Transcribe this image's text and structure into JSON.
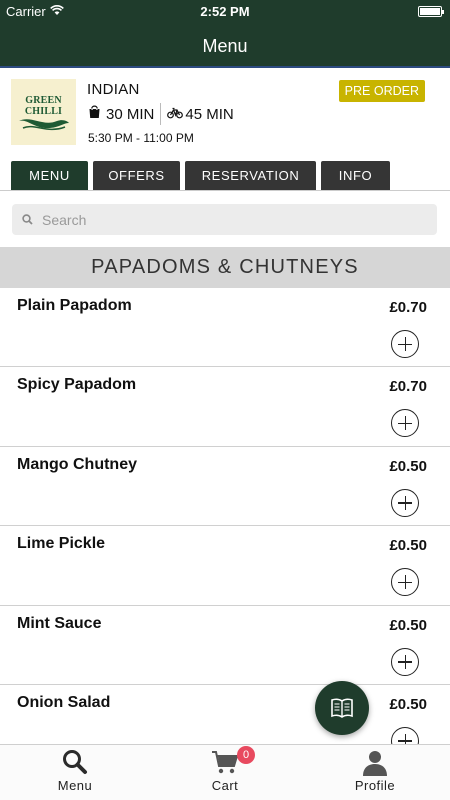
{
  "status_bar": {
    "carrier": "Carrier",
    "time": "2:52 PM"
  },
  "nav": {
    "title": "Menu"
  },
  "restaurant": {
    "logo_text": "GREEN CHILLI",
    "cuisine": "INDIAN",
    "collection_time": "30 MIN",
    "delivery_time": "45 MIN",
    "hours": "5:30 PM - 11:00 PM",
    "preorder_label": "PRE ORDER"
  },
  "tabs": [
    {
      "label": "MENU"
    },
    {
      "label": "OFFERS"
    },
    {
      "label": "RESERVATION"
    },
    {
      "label": "INFO"
    }
  ],
  "search": {
    "placeholder": "Search",
    "value": ""
  },
  "category": {
    "title": "PAPADOMS & CHUTNEYS"
  },
  "items": [
    {
      "name": "Plain Papadom",
      "price": "£0.70"
    },
    {
      "name": "Spicy Papadom",
      "price": "£0.70"
    },
    {
      "name": "Mango Chutney",
      "price": "£0.50"
    },
    {
      "name": "Lime Pickle",
      "price": "£0.50"
    },
    {
      "name": "Mint Sauce",
      "price": "£0.50"
    },
    {
      "name": "Onion Salad",
      "price": "£0.50"
    }
  ],
  "bottom_nav": {
    "menu_label": "Menu",
    "cart_label": "Cart",
    "cart_count": "0",
    "profile_label": "Profile"
  },
  "colors": {
    "brand_green": "#1f3c2c",
    "preorder_yellow": "#c8b400",
    "badge_red": "#e84a5f",
    "tab_dark": "#353535"
  },
  "icons": [
    "wifi-icon",
    "battery-icon",
    "bag-icon",
    "bicycle-icon",
    "search-icon",
    "plus-circle-icon",
    "book-icon",
    "magnifier-icon",
    "cart-icon",
    "person-icon"
  ]
}
